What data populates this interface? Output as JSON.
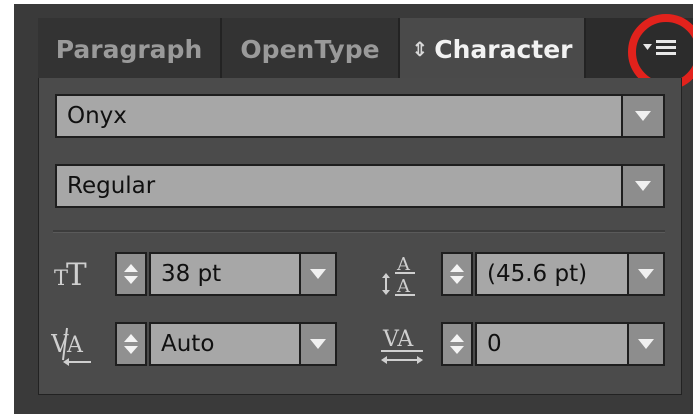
{
  "tabs": [
    {
      "label": "Paragraph",
      "active": false
    },
    {
      "label": "OpenType",
      "active": false
    },
    {
      "label": "Character",
      "active": true
    }
  ],
  "active_tab_prefix": "⇕",
  "font_family": {
    "value": "Onyx"
  },
  "font_style": {
    "value": "Regular"
  },
  "font_size": {
    "value": "38 pt"
  },
  "leading": {
    "value": "(45.6 pt)"
  },
  "kerning": {
    "value": "Auto"
  },
  "tracking": {
    "value": "0"
  },
  "colors": {
    "panel_bg": "#3a3a3a",
    "field_bg": "#a7a7a7",
    "highlight_ring": "#e2221c"
  },
  "icons": [
    "panel-menu-icon",
    "font-size-icon",
    "leading-icon",
    "kerning-icon",
    "tracking-icon",
    "chevron-down-icon",
    "stepper-icon"
  ]
}
